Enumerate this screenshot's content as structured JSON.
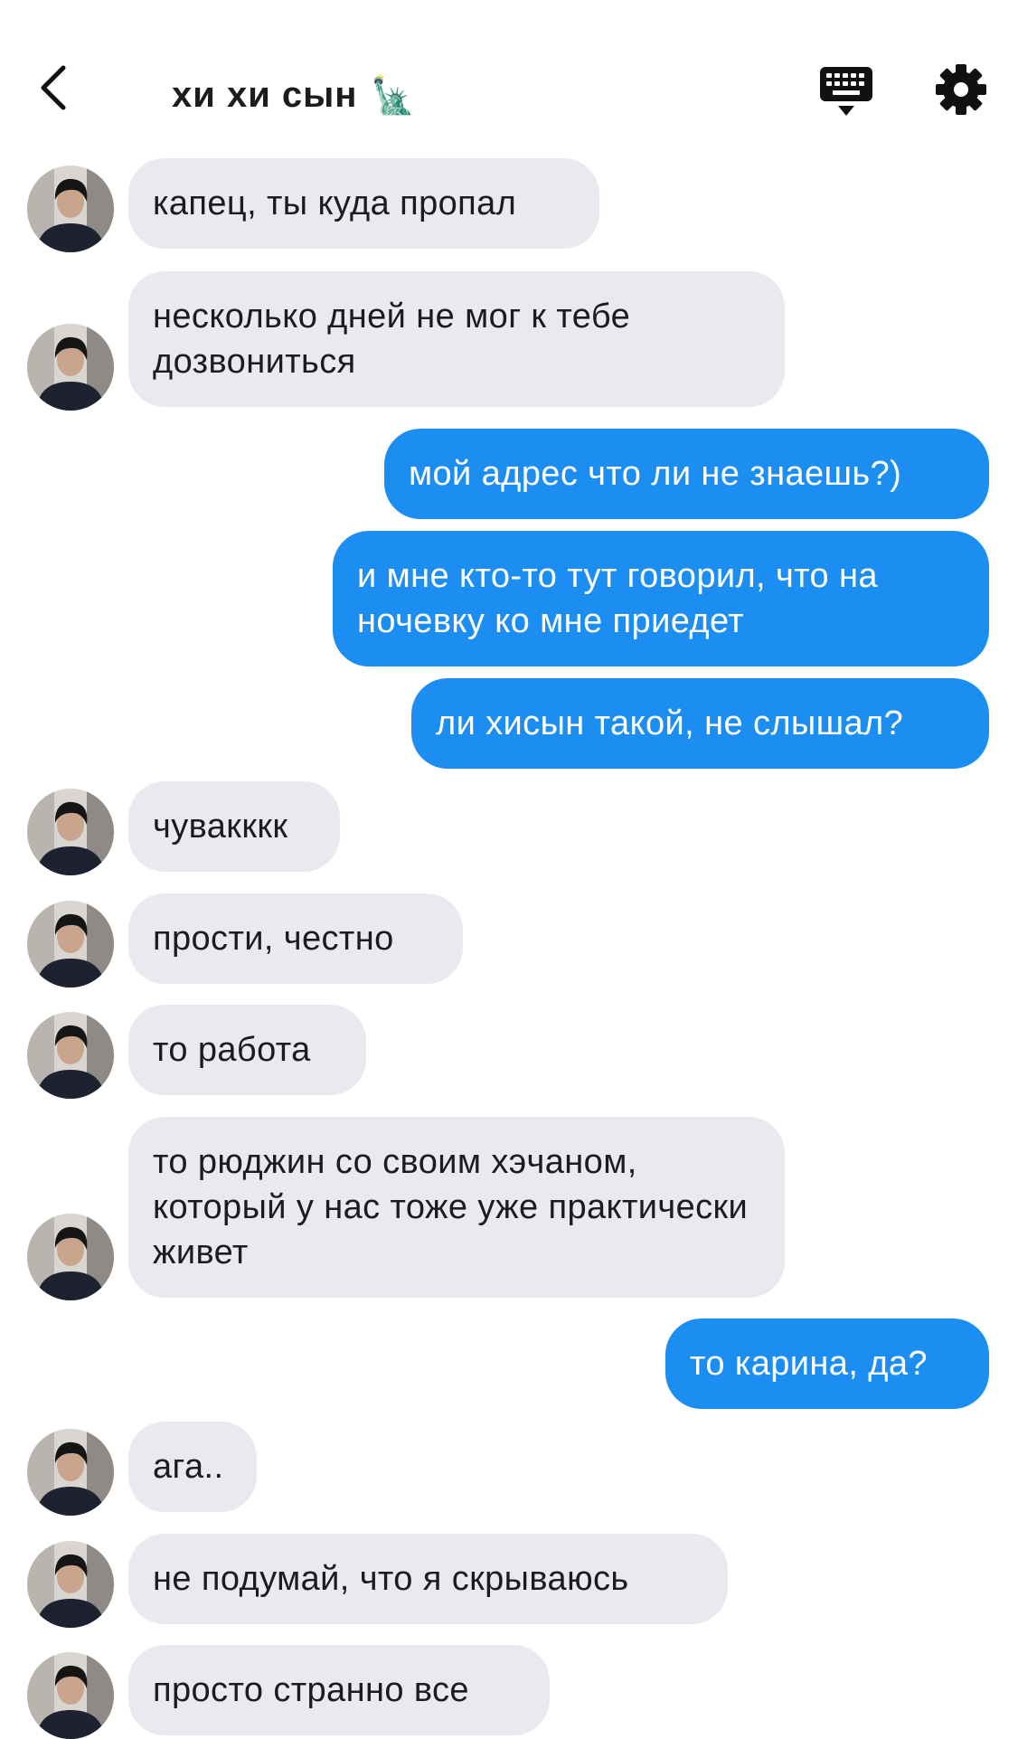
{
  "header": {
    "title": "хи хи сын",
    "title_emoji": "🗽",
    "back_icon": "chevron-left-icon",
    "keyboard_icon": "keyboard-icon",
    "settings_icon": "gear-icon"
  },
  "colors": {
    "incoming_bubble": "#e9eaf0",
    "outgoing_bubble": "#1c8ef2",
    "background": "#ffffff"
  },
  "messages": [
    {
      "side": "in",
      "text": "капец, ты куда пропал"
    },
    {
      "side": "in",
      "text": "несколько дней не мог к тебе дозвониться"
    },
    {
      "side": "out",
      "text": "мой адрес что ли не знаешь?)"
    },
    {
      "side": "out",
      "text": "и мне кто-то тут говорил, что на ночевку ко мне приедет"
    },
    {
      "side": "out",
      "text": "ли хисын такой, не слышал?"
    },
    {
      "side": "in",
      "text": "чувакккк"
    },
    {
      "side": "in",
      "text": "прости, честно"
    },
    {
      "side": "in",
      "text": "то работа"
    },
    {
      "side": "in",
      "text": "то рюджин со своим хэчаном, который у нас тоже уже практически живет"
    },
    {
      "side": "out",
      "text": "то карина, да?"
    },
    {
      "side": "in",
      "text": "ага.."
    },
    {
      "side": "in",
      "text": "не подумай, что я скрываюсь"
    },
    {
      "side": "in",
      "text": "просто странно все"
    }
  ]
}
